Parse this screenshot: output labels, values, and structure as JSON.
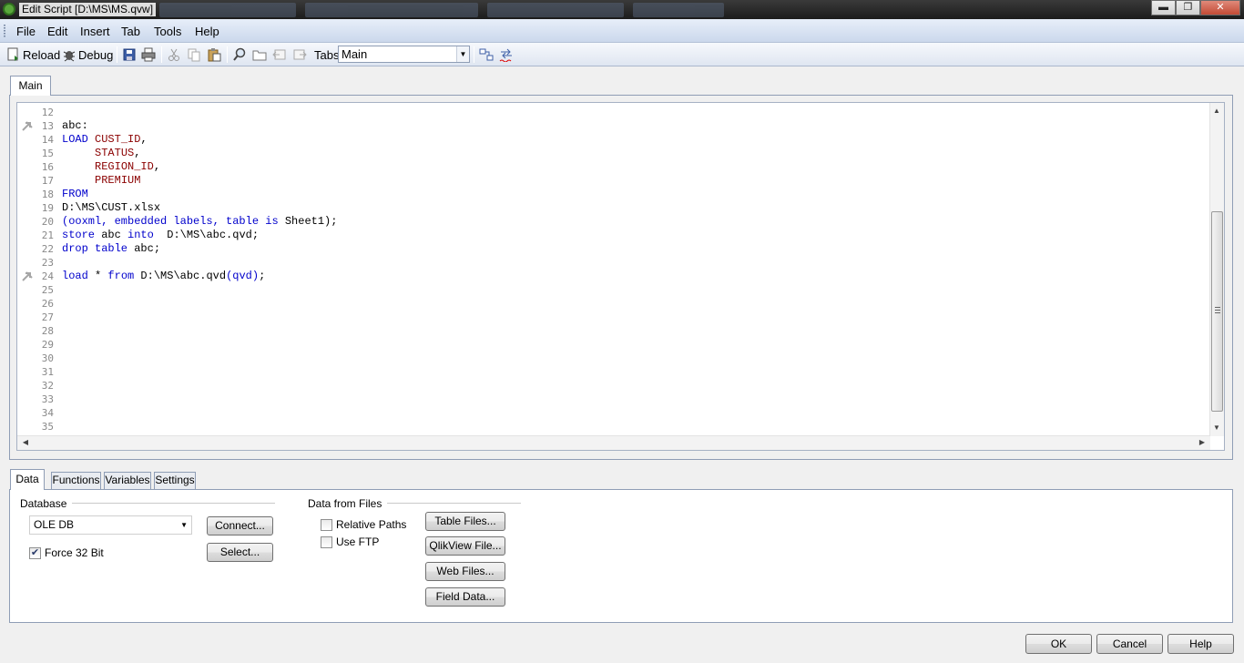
{
  "window": {
    "title": "Edit Script [D:\\MS\\MS.qvw]",
    "controls": {
      "minimize": "▬",
      "maximize": "❐",
      "close": "✕"
    }
  },
  "menu": [
    "File",
    "Edit",
    "Insert",
    "Tab",
    "Tools",
    "Help"
  ],
  "toolbar": {
    "reload_label": "Reload",
    "debug_label": "Debug",
    "tabs_label": "Tabs",
    "tabs_selected": "Main",
    "icons": [
      "reload-icon",
      "debug-icon",
      "save-icon",
      "print-icon",
      "cut-icon",
      "copy-icon",
      "paste-icon",
      "find-icon",
      "open-folder-icon",
      "tab-left-icon",
      "tab-right-icon",
      "table-viewer-icon",
      "spell-check-icon"
    ]
  },
  "editor": {
    "tab_label": "Main",
    "lines": [
      {
        "n": "12",
        "tokens": []
      },
      {
        "n": "13",
        "marker": true,
        "tokens": [
          {
            "t": "abc:",
            "c": ""
          }
        ]
      },
      {
        "n": "14",
        "tokens": [
          {
            "t": "LOAD",
            "c": "kw"
          },
          {
            "t": " ",
            "c": ""
          },
          {
            "t": "CUST_ID",
            "c": "fld"
          },
          {
            "t": ",",
            "c": ""
          }
        ]
      },
      {
        "n": "15",
        "tokens": [
          {
            "t": "     ",
            "c": ""
          },
          {
            "t": "STATUS",
            "c": "fld"
          },
          {
            "t": ",",
            "c": ""
          }
        ]
      },
      {
        "n": "16",
        "tokens": [
          {
            "t": "     ",
            "c": ""
          },
          {
            "t": "REGION_ID",
            "c": "fld"
          },
          {
            "t": ",",
            "c": ""
          }
        ]
      },
      {
        "n": "17",
        "tokens": [
          {
            "t": "     ",
            "c": ""
          },
          {
            "t": "PREMIUM",
            "c": "fld"
          }
        ]
      },
      {
        "n": "18",
        "tokens": [
          {
            "t": "FROM",
            "c": "kw"
          }
        ]
      },
      {
        "n": "19",
        "tokens": [
          {
            "t": "D:\\MS\\CUST.xlsx",
            "c": ""
          }
        ]
      },
      {
        "n": "20",
        "tokens": [
          {
            "t": "(ooxml, embedded labels, table is",
            "c": "kw"
          },
          {
            "t": " Sheet1);",
            "c": ""
          }
        ]
      },
      {
        "n": "21",
        "tokens": [
          {
            "t": "store",
            "c": "kw"
          },
          {
            "t": " abc ",
            "c": ""
          },
          {
            "t": "into",
            "c": "kw"
          },
          {
            "t": "  D:\\MS\\abc.qvd;",
            "c": ""
          }
        ]
      },
      {
        "n": "22",
        "tokens": [
          {
            "t": "drop table",
            "c": "kw"
          },
          {
            "t": " abc;",
            "c": ""
          }
        ]
      },
      {
        "n": "23",
        "tokens": []
      },
      {
        "n": "24",
        "marker": true,
        "tokens": [
          {
            "t": "load",
            "c": "kw"
          },
          {
            "t": " * ",
            "c": ""
          },
          {
            "t": "from",
            "c": "kw"
          },
          {
            "t": " D:\\MS\\abc.qvd",
            "c": ""
          },
          {
            "t": "(qvd)",
            "c": "kw"
          },
          {
            "t": ";",
            "c": ""
          }
        ]
      },
      {
        "n": "25",
        "tokens": []
      },
      {
        "n": "26",
        "tokens": []
      },
      {
        "n": "27",
        "tokens": []
      },
      {
        "n": "28",
        "tokens": []
      },
      {
        "n": "29",
        "tokens": []
      },
      {
        "n": "30",
        "tokens": []
      },
      {
        "n": "31",
        "tokens": []
      },
      {
        "n": "32",
        "tokens": []
      },
      {
        "n": "33",
        "tokens": []
      },
      {
        "n": "34",
        "tokens": []
      },
      {
        "n": "35",
        "tokens": []
      }
    ]
  },
  "bottom_tabs": [
    "Data",
    "Functions",
    "Variables",
    "Settings"
  ],
  "data_panel": {
    "database_title": "Database",
    "database_selected": "OLE DB",
    "connect_button": "Connect...",
    "select_button": "Select...",
    "force32_label": "Force 32 Bit",
    "force32_checked": true,
    "files_title": "Data from Files",
    "relative_paths_label": "Relative Paths",
    "relative_paths_checked": false,
    "use_ftp_label": "Use FTP",
    "use_ftp_checked": false,
    "table_files_button": "Table Files...",
    "qlikview_file_button": "QlikView File...",
    "web_files_button": "Web Files...",
    "field_data_button": "Field Data..."
  },
  "dialog_buttons": {
    "ok": "OK",
    "cancel": "Cancel",
    "help": "Help"
  },
  "colors": {
    "keyword": "#0000cc",
    "field": "#8b0000",
    "menu_bg": "#dce6f4"
  }
}
